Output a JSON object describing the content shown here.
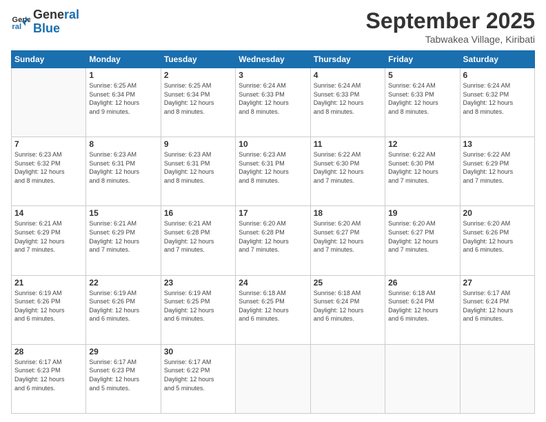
{
  "logo": {
    "line1": "General",
    "line2": "Blue"
  },
  "header": {
    "month": "September 2025",
    "location": "Tabwakea Village, Kiribati"
  },
  "weekdays": [
    "Sunday",
    "Monday",
    "Tuesday",
    "Wednesday",
    "Thursday",
    "Friday",
    "Saturday"
  ],
  "weeks": [
    [
      {
        "day": "",
        "info": ""
      },
      {
        "day": "1",
        "info": "Sunrise: 6:25 AM\nSunset: 6:34 PM\nDaylight: 12 hours\nand 9 minutes."
      },
      {
        "day": "2",
        "info": "Sunrise: 6:25 AM\nSunset: 6:34 PM\nDaylight: 12 hours\nand 8 minutes."
      },
      {
        "day": "3",
        "info": "Sunrise: 6:24 AM\nSunset: 6:33 PM\nDaylight: 12 hours\nand 8 minutes."
      },
      {
        "day": "4",
        "info": "Sunrise: 6:24 AM\nSunset: 6:33 PM\nDaylight: 12 hours\nand 8 minutes."
      },
      {
        "day": "5",
        "info": "Sunrise: 6:24 AM\nSunset: 6:33 PM\nDaylight: 12 hours\nand 8 minutes."
      },
      {
        "day": "6",
        "info": "Sunrise: 6:24 AM\nSunset: 6:32 PM\nDaylight: 12 hours\nand 8 minutes."
      }
    ],
    [
      {
        "day": "7",
        "info": "Sunrise: 6:23 AM\nSunset: 6:32 PM\nDaylight: 12 hours\nand 8 minutes."
      },
      {
        "day": "8",
        "info": "Sunrise: 6:23 AM\nSunset: 6:31 PM\nDaylight: 12 hours\nand 8 minutes."
      },
      {
        "day": "9",
        "info": "Sunrise: 6:23 AM\nSunset: 6:31 PM\nDaylight: 12 hours\nand 8 minutes."
      },
      {
        "day": "10",
        "info": "Sunrise: 6:23 AM\nSunset: 6:31 PM\nDaylight: 12 hours\nand 8 minutes."
      },
      {
        "day": "11",
        "info": "Sunrise: 6:22 AM\nSunset: 6:30 PM\nDaylight: 12 hours\nand 7 minutes."
      },
      {
        "day": "12",
        "info": "Sunrise: 6:22 AM\nSunset: 6:30 PM\nDaylight: 12 hours\nand 7 minutes."
      },
      {
        "day": "13",
        "info": "Sunrise: 6:22 AM\nSunset: 6:29 PM\nDaylight: 12 hours\nand 7 minutes."
      }
    ],
    [
      {
        "day": "14",
        "info": "Sunrise: 6:21 AM\nSunset: 6:29 PM\nDaylight: 12 hours\nand 7 minutes."
      },
      {
        "day": "15",
        "info": "Sunrise: 6:21 AM\nSunset: 6:29 PM\nDaylight: 12 hours\nand 7 minutes."
      },
      {
        "day": "16",
        "info": "Sunrise: 6:21 AM\nSunset: 6:28 PM\nDaylight: 12 hours\nand 7 minutes."
      },
      {
        "day": "17",
        "info": "Sunrise: 6:20 AM\nSunset: 6:28 PM\nDaylight: 12 hours\nand 7 minutes."
      },
      {
        "day": "18",
        "info": "Sunrise: 6:20 AM\nSunset: 6:27 PM\nDaylight: 12 hours\nand 7 minutes."
      },
      {
        "day": "19",
        "info": "Sunrise: 6:20 AM\nSunset: 6:27 PM\nDaylight: 12 hours\nand 7 minutes."
      },
      {
        "day": "20",
        "info": "Sunrise: 6:20 AM\nSunset: 6:26 PM\nDaylight: 12 hours\nand 6 minutes."
      }
    ],
    [
      {
        "day": "21",
        "info": "Sunrise: 6:19 AM\nSunset: 6:26 PM\nDaylight: 12 hours\nand 6 minutes."
      },
      {
        "day": "22",
        "info": "Sunrise: 6:19 AM\nSunset: 6:26 PM\nDaylight: 12 hours\nand 6 minutes."
      },
      {
        "day": "23",
        "info": "Sunrise: 6:19 AM\nSunset: 6:25 PM\nDaylight: 12 hours\nand 6 minutes."
      },
      {
        "day": "24",
        "info": "Sunrise: 6:18 AM\nSunset: 6:25 PM\nDaylight: 12 hours\nand 6 minutes."
      },
      {
        "day": "25",
        "info": "Sunrise: 6:18 AM\nSunset: 6:24 PM\nDaylight: 12 hours\nand 6 minutes."
      },
      {
        "day": "26",
        "info": "Sunrise: 6:18 AM\nSunset: 6:24 PM\nDaylight: 12 hours\nand 6 minutes."
      },
      {
        "day": "27",
        "info": "Sunrise: 6:17 AM\nSunset: 6:24 PM\nDaylight: 12 hours\nand 6 minutes."
      }
    ],
    [
      {
        "day": "28",
        "info": "Sunrise: 6:17 AM\nSunset: 6:23 PM\nDaylight: 12 hours\nand 6 minutes."
      },
      {
        "day": "29",
        "info": "Sunrise: 6:17 AM\nSunset: 6:23 PM\nDaylight: 12 hours\nand 5 minutes."
      },
      {
        "day": "30",
        "info": "Sunrise: 6:17 AM\nSunset: 6:22 PM\nDaylight: 12 hours\nand 5 minutes."
      },
      {
        "day": "",
        "info": ""
      },
      {
        "day": "",
        "info": ""
      },
      {
        "day": "",
        "info": ""
      },
      {
        "day": "",
        "info": ""
      }
    ]
  ]
}
